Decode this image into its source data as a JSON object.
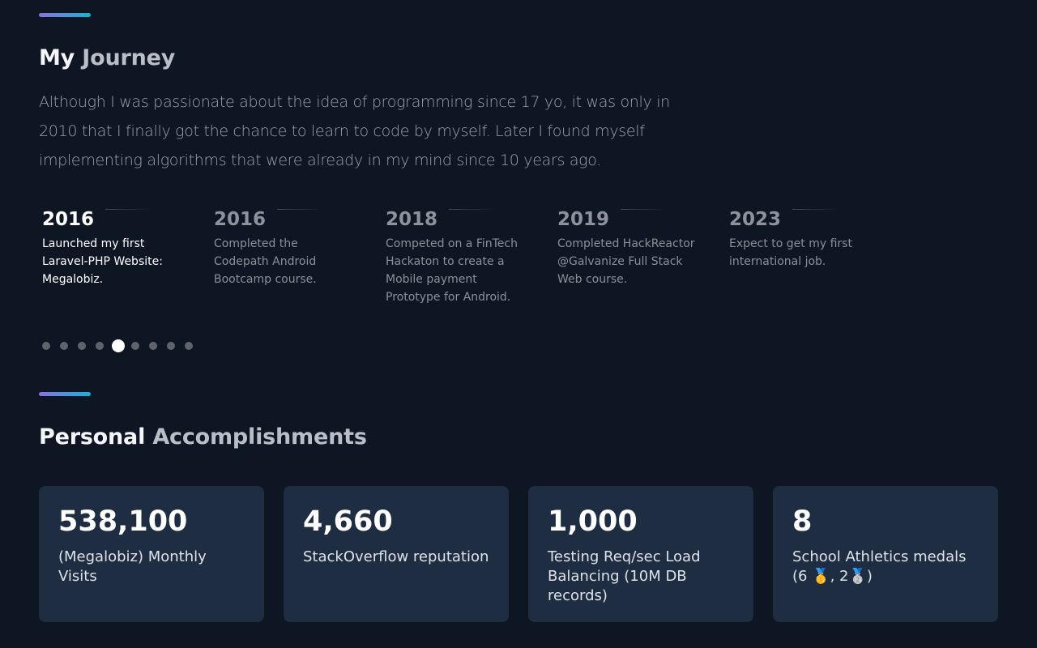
{
  "journey": {
    "title_part1": "My",
    "title_part2": "Journey",
    "intro": "Although I was passionate about the idea of programming since 17 yo, it was only in 2010 that I finally got the chance to learn to code by myself. Later I found myself implementing algorithms that were already in my mind since 10 years ago."
  },
  "timeline": [
    {
      "year": "2016",
      "text": "Launched my first Laravel-PHP Website: Megalobiz.",
      "active": true
    },
    {
      "year": "2016",
      "text": "Completed the Codepath Android Bootcamp course.",
      "active": false
    },
    {
      "year": "2018",
      "text": "Competed on a FinTech Hackaton to create a Mobile payment Prototype for Android.",
      "active": false
    },
    {
      "year": "2019",
      "text": "Completed HackReactor @Galvanize Full Stack Web course.",
      "active": false
    },
    {
      "year": "2023",
      "text": "Expect to get my first international job.",
      "active": false
    }
  ],
  "pagination": {
    "total": 9,
    "active_index": 4
  },
  "accomplishments": {
    "title_part1": "Personal",
    "title_part2": "Accomplishments",
    "cards": [
      {
        "value": "538,100",
        "label": "(Megalobiz) Monthly Visits"
      },
      {
        "value": "4,660",
        "label": "StackOverflow reputation"
      },
      {
        "value": "1,000",
        "label": "Testing Req/sec Load Balancing (10M DB records)"
      },
      {
        "value": "8",
        "label": "School Athletics medals (6 🥇, 2🥈)"
      }
    ]
  },
  "colors": {
    "background": "#0f1623",
    "card": "#1f2d42",
    "accent_start": "#8b6fe0",
    "accent_end": "#15b4d6"
  }
}
